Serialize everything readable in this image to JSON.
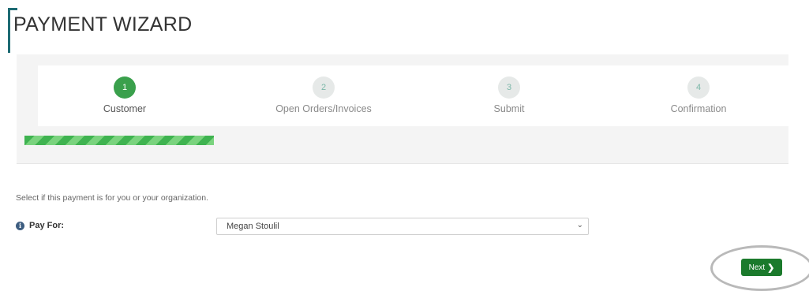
{
  "page": {
    "title": "PAYMENT WIZARD"
  },
  "wizard": {
    "steps": [
      {
        "number": "1",
        "label": "Customer"
      },
      {
        "number": "2",
        "label": "Open Orders/Invoices"
      },
      {
        "number": "3",
        "label": "Submit"
      },
      {
        "number": "4",
        "label": "Confirmation"
      }
    ],
    "active_step": 1,
    "progress_fraction": 0.25
  },
  "form": {
    "instruction": "Select if this payment is for you or your organization.",
    "pay_for": {
      "label": "Pay For:",
      "value": "Megan Stoulil"
    }
  },
  "actions": {
    "next_label": "Next",
    "next_icon": "chevron-right-icon"
  },
  "colors": {
    "accent": "#3aa04c",
    "button": "#1b7a2c",
    "brand": "#1d6b73"
  }
}
